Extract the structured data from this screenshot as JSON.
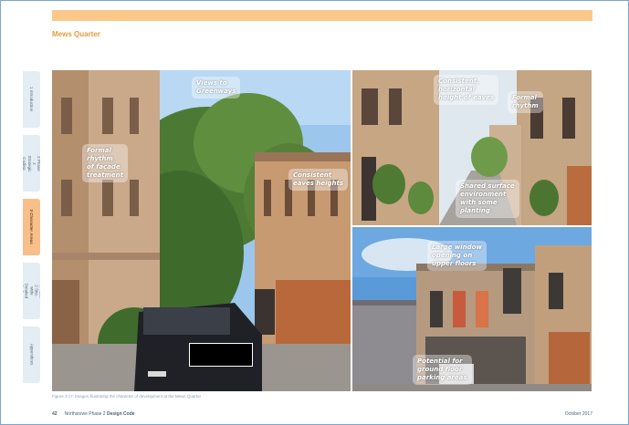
{
  "section_title": "Mews Quarter",
  "side_tabs": [
    {
      "label": "1 Introduction",
      "active": false
    },
    {
      "label": "2 Phase 2\nStrategic Coding",
      "active": false
    },
    {
      "label": "3 Character Areas",
      "active": true
    },
    {
      "label": "4 Phase 2 Site-wide\nDetailed Coding",
      "active": false
    },
    {
      "label": "Appendices",
      "active": false
    }
  ],
  "callouts": {
    "views": "Views to\nGreenways",
    "formal_facade": "Formal\nrhythm\nof façade\ntreatment",
    "eaves_heights": "Consistent\neaves heights",
    "horizontal_eaves": "Consistent,\nhorizontal\nheight of eaves",
    "formal_rhythm": "Formal\nrhythm",
    "shared_surface": "Shared surface\nenvironment\nwith some\nplanting",
    "large_window": "Large window\nopening on\nupper floors",
    "parking": "Potential for\nground floor\nparking areas"
  },
  "caption": "Figure 3.17: Images illustrating the character of development at the Mews Quarter",
  "footer": {
    "page_number": "42",
    "doc_name_prefix": "Northstowe Phase 2 ",
    "doc_name_bold": "Design Code",
    "date": "October 2017"
  },
  "colors": {
    "accent_orange": "#fbc889",
    "title_orange": "#e89a3c",
    "frame_blue": "#7aa6cf"
  }
}
